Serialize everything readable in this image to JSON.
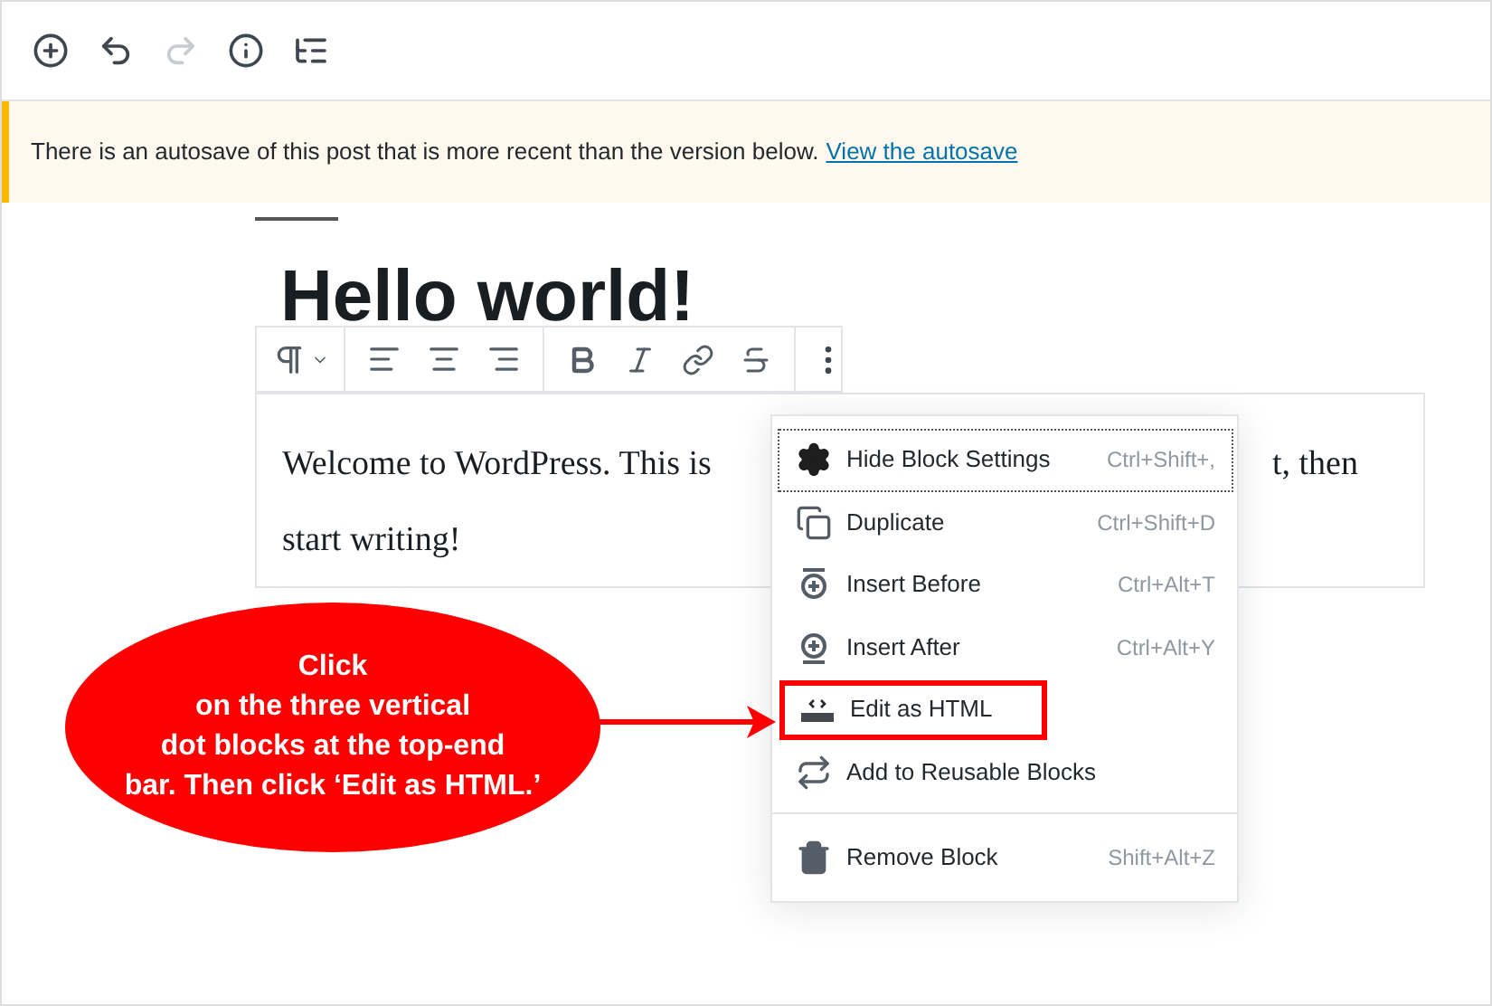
{
  "top_toolbar": [
    {
      "disabled": false
    },
    {
      "disabled": false
    },
    {
      "disabled": true
    },
    {
      "disabled": false
    },
    {
      "disabled": false
    }
  ],
  "notice": {
    "text": "There is an autosave of this post that is more recent than the version below.",
    "link": "View the autosave"
  },
  "post": {
    "title": "Hello world!",
    "paragraph_lines": [
      [
        "Welcome to WordPress. This is",
        "t, then"
      ],
      [
        "start writing!"
      ]
    ]
  },
  "menu": {
    "sections": [
      [
        {
          "label": "Hide Block Settings",
          "shortcut": "Ctrl+Shift+,",
          "focused": true,
          "highlighted": false
        },
        {
          "label": "Duplicate",
          "shortcut": "Ctrl+Shift+D",
          "focused": false,
          "highlighted": false
        },
        {
          "label": "Insert Before",
          "shortcut": "Ctrl+Alt+T",
          "focused": false,
          "highlighted": false
        },
        {
          "label": "Insert After",
          "shortcut": "Ctrl+Alt+Y",
          "focused": false,
          "highlighted": false
        },
        {
          "label": "Edit as HTML",
          "focused": false,
          "highlighted": true
        },
        {
          "label": "Add to Reusable Blocks",
          "focused": false,
          "highlighted": false
        }
      ],
      [
        {
          "label": "Remove Block",
          "shortcut": "Shift+Alt+Z",
          "focused": false,
          "highlighted": false
        }
      ]
    ]
  },
  "callout": {
    "lines": [
      "Click",
      "on the three vertical",
      "dot blocks at the top-end",
      "bar. Then click ‘Edit as HTML.’"
    ]
  }
}
